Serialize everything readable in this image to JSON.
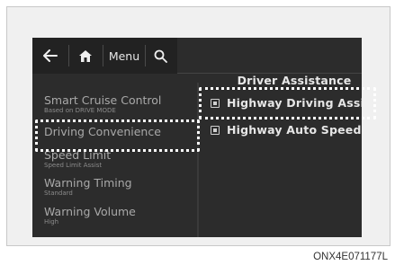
{
  "topbar": {
    "back_icon": "back-arrow-icon",
    "home_icon": "home-icon",
    "menu_label": "Menu",
    "search_icon": "search-icon"
  },
  "section_title": "Driver Assistance",
  "left_menu": [
    {
      "title": "Smart Cruise Control",
      "subtitle": "Based on DRIVE MODE"
    },
    {
      "title": "Driving Convenience",
      "subtitle": ""
    },
    {
      "title": "Speed Limit",
      "subtitle": "Speed Limit Assist"
    },
    {
      "title": "Warning Timing",
      "subtitle": "Standard"
    },
    {
      "title": "Warning Volume",
      "subtitle": "High"
    }
  ],
  "right_menu": [
    {
      "label": "Highway Driving Assist",
      "checked": true
    },
    {
      "label": "Highway Auto Speed...",
      "checked": true
    }
  ],
  "caption": "ONX4E071177L",
  "colors": {
    "screen_bg": "#2c2c2c",
    "highlight_border": "#ffffff",
    "text_primary": "#e6e6e6",
    "text_secondary": "#a9a9a9"
  }
}
